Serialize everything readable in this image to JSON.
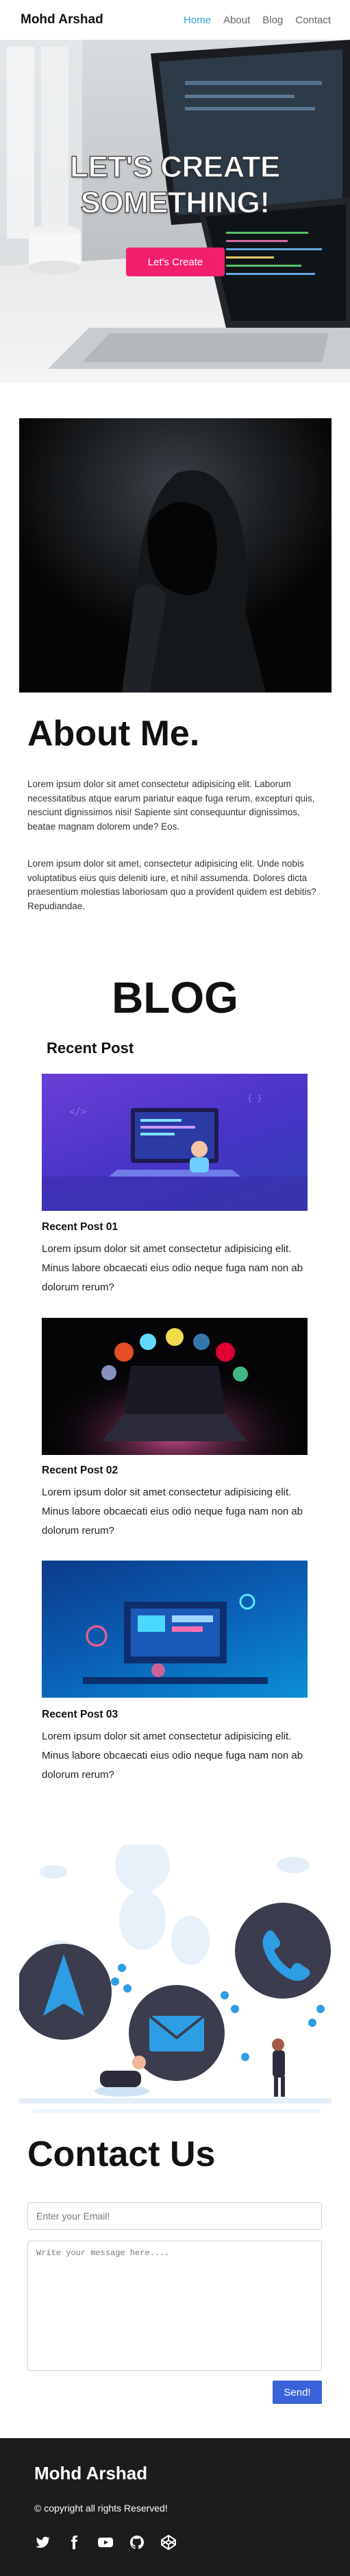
{
  "nav": {
    "brand": "Mohd Arshad",
    "links": [
      {
        "label": "Home",
        "active": true
      },
      {
        "label": "About",
        "active": false
      },
      {
        "label": "Blog",
        "active": false
      },
      {
        "label": "Contact",
        "active": false
      }
    ]
  },
  "hero": {
    "title_line1": "LET'S CREATE",
    "title_line2": "SOMETHING!",
    "cta_label": "Let's Create"
  },
  "about": {
    "title": "About Me.",
    "paragraph1": "Lorem ipsum dolor sit amet consectetur adipisicing elit. Laborum necessitatibus atque earum pariatur eaque fuga rerum, excepturi quis, nesciunt dignissimos nisi! Sapiente sint consequuntur dignissimos, beatae magnam dolorem unde? Eos.",
    "paragraph2": "Lorem ipsum dolor sit amet, consectetur adipisicing elit. Unde nobis voluptatibus eius quis deleniti iure, et nihil assumenda. Dolores dicta praesentium molestias laboriosam quo a provident quidem est debitis? Repudiandae."
  },
  "blog": {
    "title": "BLOG",
    "recent_heading": "Recent Post",
    "posts": [
      {
        "title": "Recent Post 01",
        "text": "Lorem ipsum dolor sit amet consectetur adipisicing elit. Minus labore obcaecati eius odio neque fuga nam non ab dolorum rerum?"
      },
      {
        "title": "Recent Post 02",
        "text": "Lorem ipsum dolor sit amet consectetur adipisicing elit. Minus labore obcaecati eius odio neque fuga nam non ab dolorum rerum?"
      },
      {
        "title": "Recent Post 03",
        "text": "Lorem ipsum dolor sit amet consectetur adipisicing elit. Minus labore obcaecati eius odio neque fuga nam non ab dolorum rerum?"
      }
    ]
  },
  "contact": {
    "title": "Contact Us",
    "email_placeholder": "Enter your Email!",
    "message_placeholder": "Write your message here....",
    "send_label": "Send!"
  },
  "footer": {
    "brand": "Mohd Arshad",
    "copyright": "© copyright all rights Reserved!",
    "socials": [
      "twitter-icon",
      "facebook-icon",
      "youtube-icon",
      "github-icon",
      "codepen-icon"
    ]
  },
  "colors": {
    "accent_nav": "#2aa7e0",
    "hero_button": "#f21f6c",
    "send_button": "#3b62d8",
    "footer_bg": "#1c1c1c",
    "illustration_blue": "#2d9de4",
    "illustration_dark": "#3a3a4a"
  }
}
